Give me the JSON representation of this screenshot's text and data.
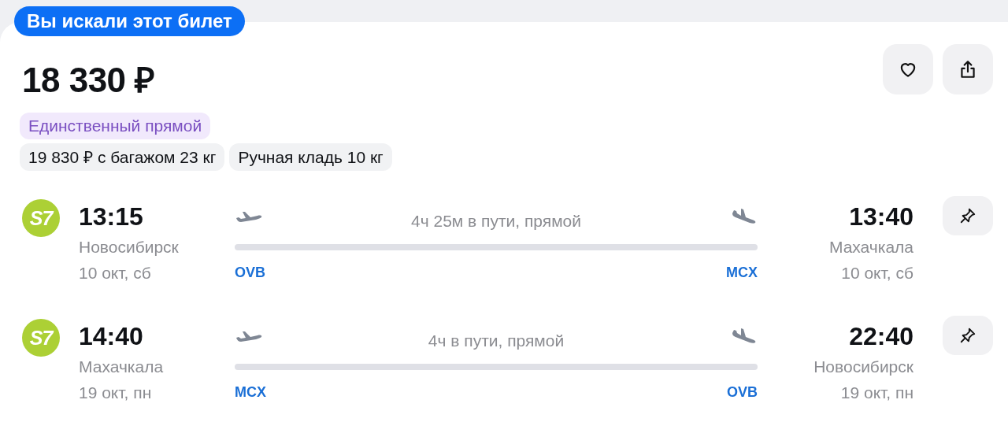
{
  "badge": "Вы искали этот билет",
  "price": "18 330 ₽",
  "highlight_tag": "Единственный прямой",
  "tags": [
    "19 830 ₽ с багажом 23 кг",
    "Ручная кладь 10 кг"
  ],
  "segments": [
    {
      "airline_logo": "S7",
      "duration": "4ч 25м в пути, прямой",
      "departure": {
        "time": "13:15",
        "city": "Новосибирск",
        "date": "10 окт, сб",
        "code": "OVB"
      },
      "arrival": {
        "time": "13:40",
        "city": "Махачкала",
        "date": "10 окт, сб",
        "code": "MCX"
      }
    },
    {
      "airline_logo": "S7",
      "duration": "4ч в пути, прямой",
      "departure": {
        "time": "14:40",
        "city": "Махачкала",
        "date": "19 окт, пн",
        "code": "MCX"
      },
      "arrival": {
        "time": "22:40",
        "city": "Новосибирск",
        "date": "19 окт, пн",
        "code": "OVB"
      }
    }
  ]
}
